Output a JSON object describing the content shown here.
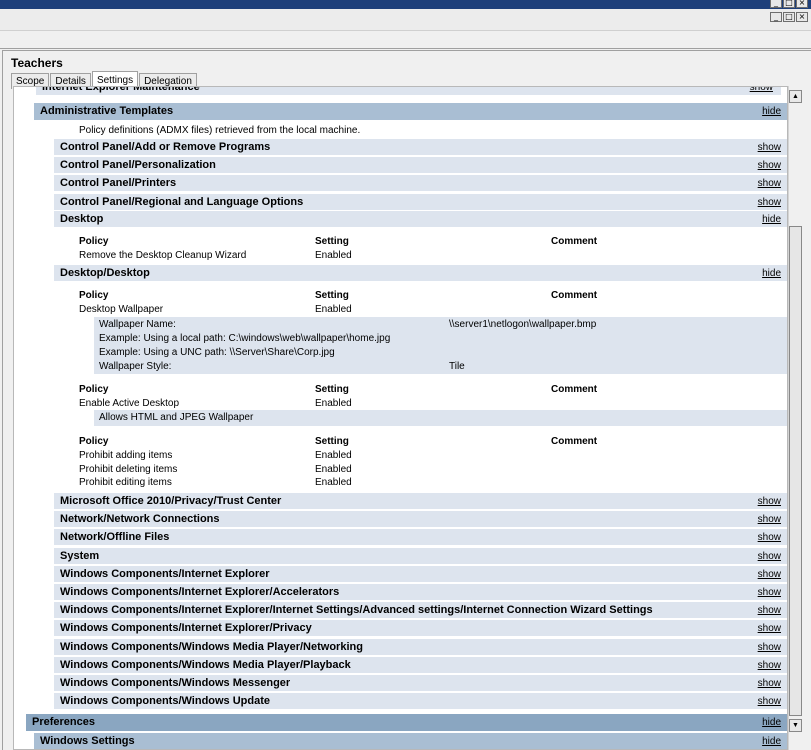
{
  "window": {
    "title": "Teachers",
    "tabs": [
      "Scope",
      "Details",
      "Settings",
      "Delegation"
    ],
    "active_tab": "Settings",
    "controls": [
      "_",
      "□",
      "×"
    ]
  },
  "report": {
    "top_partial": {
      "label": "Internet Explorer Maintenance",
      "link": "show"
    },
    "admin_templates": {
      "label": "Administrative Templates",
      "link": "hide",
      "note": "Policy definitions (ADMX files) retrieved from the local machine."
    },
    "sections_before": [
      {
        "label": "Control Panel/Add or Remove Programs",
        "link": "show"
      },
      {
        "label": "Control Panel/Personalization",
        "link": "show"
      },
      {
        "label": "Control Panel/Printers",
        "link": "show"
      },
      {
        "label": "Control Panel/Regional and Language Options",
        "link": "show"
      }
    ],
    "desktop": {
      "label": "Desktop",
      "link": "hide",
      "headers": [
        "Policy",
        "Setting",
        "Comment"
      ],
      "rows": [
        {
          "policy": "Remove the Desktop Cleanup Wizard",
          "setting": "Enabled"
        }
      ]
    },
    "desktop_desktop": {
      "label": "Desktop/Desktop",
      "link": "hide",
      "headers": [
        "Policy",
        "Setting",
        "Comment"
      ],
      "wallpaper": {
        "policy": "Desktop Wallpaper",
        "setting": "Enabled"
      },
      "wallpaper_details": {
        "name_label": "Wallpaper Name:",
        "name_value": "\\\\server1\\netlogon\\wallpaper.bmp",
        "example1": "Example: Using a local path:  C:\\windows\\web\\wallpaper\\home.jpg",
        "example2": "Example: Using a UNC path:  \\\\Server\\Share\\Corp.jpg",
        "style_label": "Wallpaper Style:",
        "style_value": "Tile"
      },
      "active_desktop": {
        "policy": "Enable Active Desktop",
        "setting": "Enabled"
      },
      "active_desktop_detail": "Allows HTML and JPEG Wallpaper",
      "prohibit": [
        {
          "policy": "Prohibit adding items",
          "setting": "Enabled"
        },
        {
          "policy": "Prohibit deleting items",
          "setting": "Enabled"
        },
        {
          "policy": "Prohibit editing items",
          "setting": "Enabled"
        }
      ]
    },
    "sections_after": [
      {
        "label": "Microsoft Office 2010/Privacy/Trust Center",
        "link": "show"
      },
      {
        "label": "Network/Network Connections",
        "link": "show"
      },
      {
        "label": "Network/Offline Files",
        "link": "show"
      },
      {
        "label": "System",
        "link": "show"
      },
      {
        "label": "Windows Components/Internet Explorer",
        "link": "show"
      },
      {
        "label": "Windows Components/Internet Explorer/Accelerators",
        "link": "show"
      },
      {
        "label": "Windows Components/Internet Explorer/Internet Settings/Advanced settings/Internet Connection Wizard Settings",
        "link": "show"
      },
      {
        "label": "Windows Components/Internet Explorer/Privacy",
        "link": "show"
      },
      {
        "label": "Windows Components/Windows Media Player/Networking",
        "link": "show"
      },
      {
        "label": "Windows Components/Windows Media Player/Playback",
        "link": "show"
      },
      {
        "label": "Windows Components/Windows Messenger",
        "link": "show"
      },
      {
        "label": "Windows Components/Windows Update",
        "link": "show"
      }
    ],
    "preferences": {
      "label": "Preferences",
      "link": "hide"
    },
    "windows_settings": {
      "label": "Windows Settings",
      "link": "hide"
    }
  }
}
